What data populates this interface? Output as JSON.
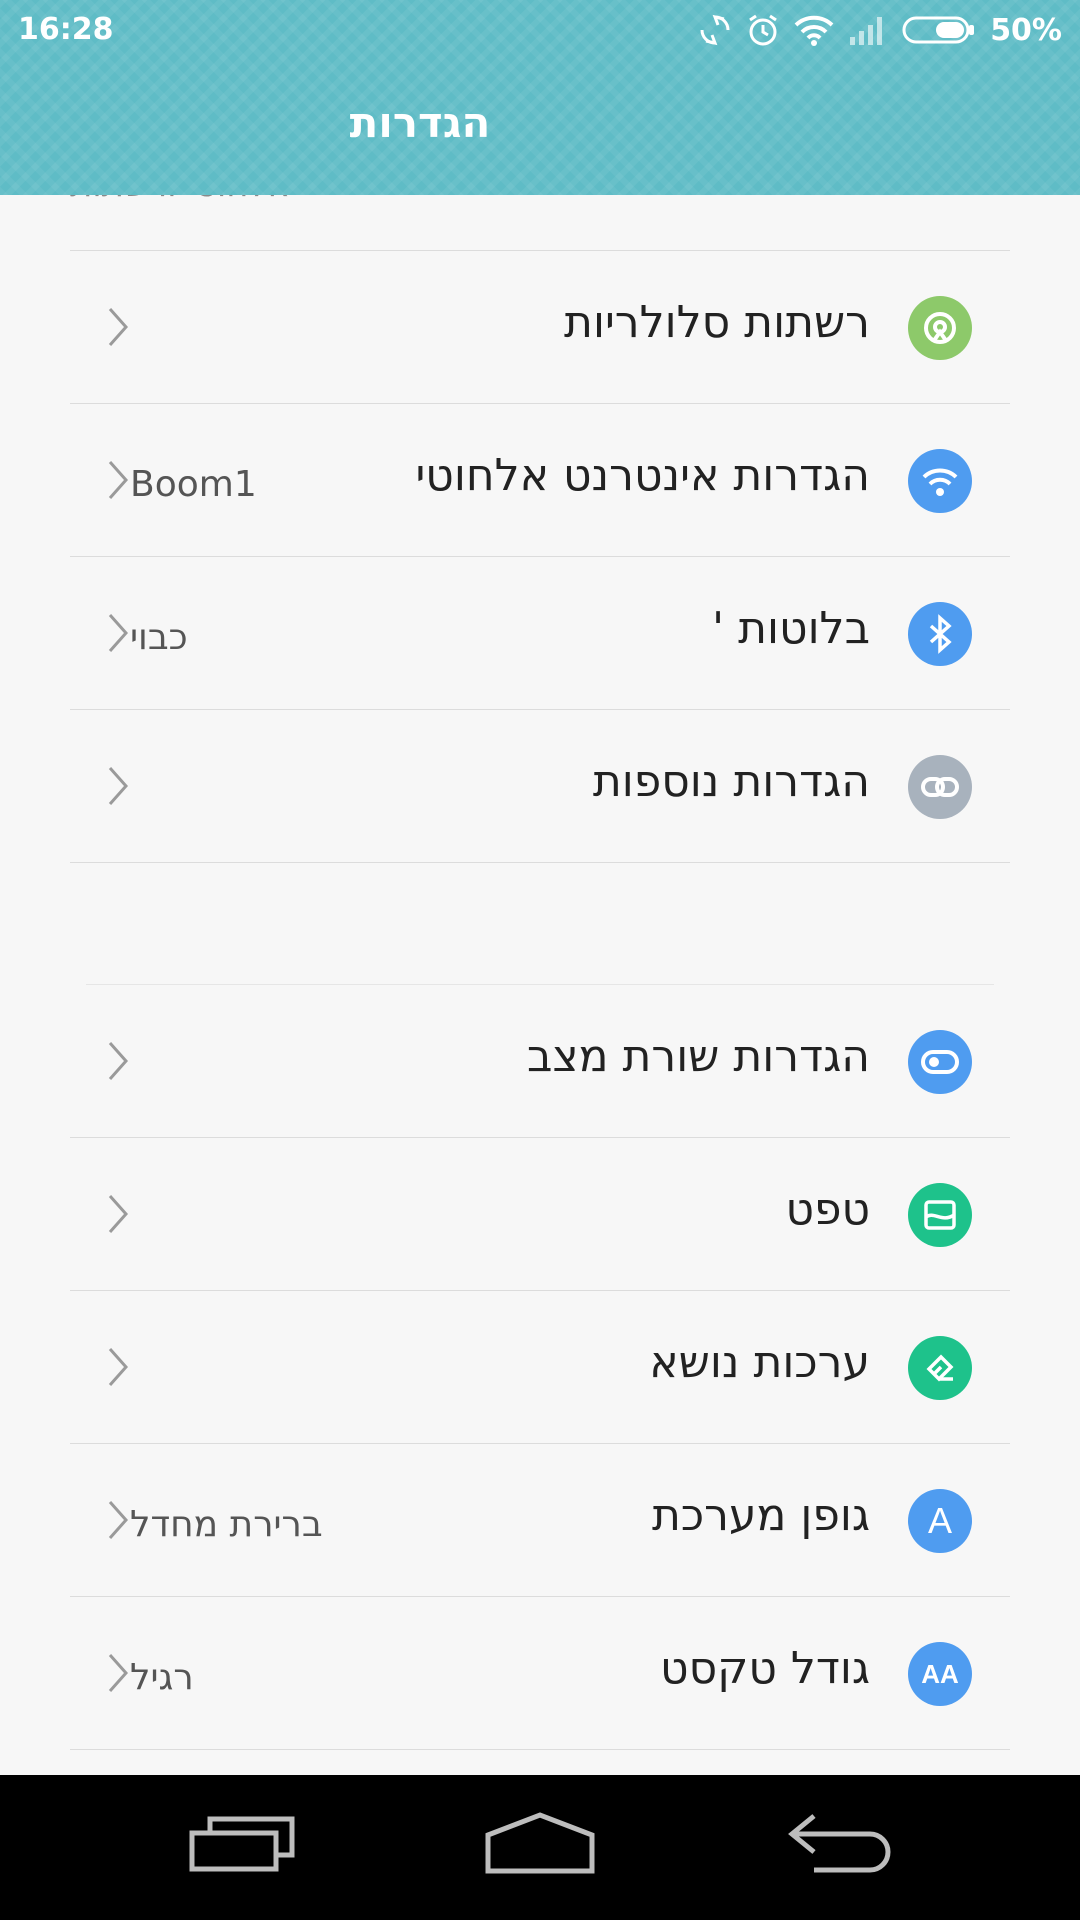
{
  "status_bar": {
    "time": "16:28",
    "battery_percent": "50%",
    "icons": [
      "sync-icon",
      "alarm-icon",
      "wifi-icon",
      "signal-icon",
      "battery-icon"
    ]
  },
  "header": {
    "title": "הגדרות"
  },
  "section_partial_label": "אלחוטי ורשתות",
  "groups": [
    {
      "items": [
        {
          "label": "רשתות סלולריות",
          "value": "",
          "icon": "cellular-network-icon",
          "color": "#8dc96a"
        },
        {
          "label": "הגדרות אינטרנט אלחוטי",
          "value": "Boom1",
          "icon": "wifi-icon",
          "color": "#4f9cf0"
        },
        {
          "label": "בלוטות '",
          "value": "כבוי",
          "icon": "bluetooth-icon",
          "color": "#4f9cf0"
        },
        {
          "label": "הגדרות נוספות",
          "value": "",
          "icon": "link-icon",
          "color": "#a8b2bd"
        }
      ]
    },
    {
      "items": [
        {
          "label": "הגדרות שורת מצב",
          "value": "",
          "icon": "status-bar-toggle-icon",
          "color": "#4f9cf0"
        },
        {
          "label": "טפט",
          "value": "",
          "icon": "wallpaper-icon",
          "color": "#1ec28b"
        },
        {
          "label": "ערכות נושא",
          "value": "",
          "icon": "theme-brush-icon",
          "color": "#1ec28b"
        },
        {
          "label": "גופן מערכת",
          "value": "ברירת מחדל",
          "icon": "font-icon",
          "color": "#4f9cf0"
        },
        {
          "label": "גודל טקסט",
          "value": "רגיל",
          "icon": "text-size-icon",
          "color": "#4f9cf0"
        }
      ]
    }
  ],
  "icon_glyphs": {
    "font_letter": "A",
    "text_size_letters": "AA"
  },
  "nav": {
    "buttons": [
      "recent-apps-button",
      "home-button",
      "back-button"
    ]
  }
}
